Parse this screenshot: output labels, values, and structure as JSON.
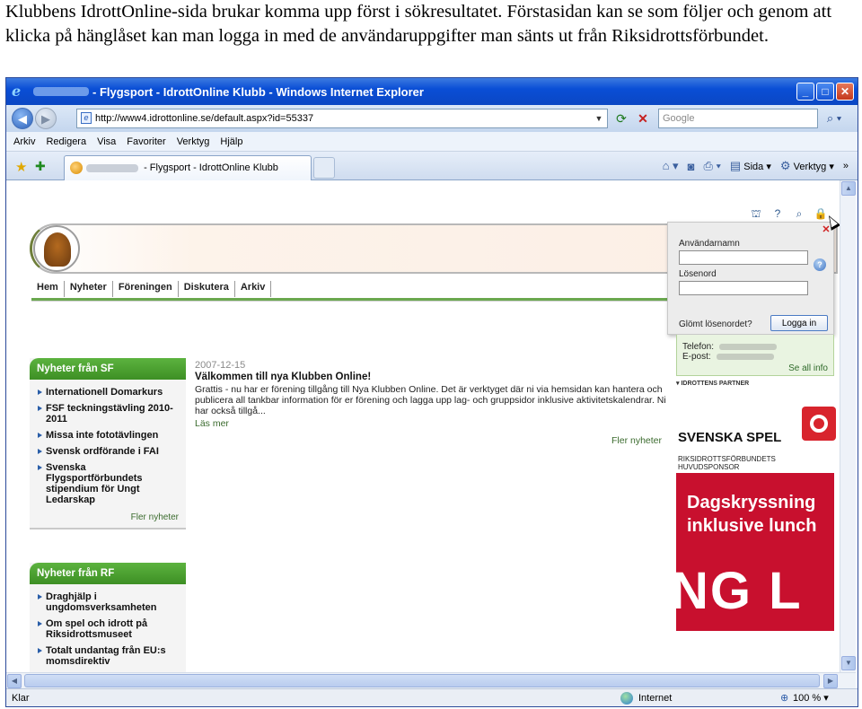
{
  "caption": "Klubbens IdrottOnline-sida brukar komma upp först i sökresultatet. Förstasidan kan se som följer och genom att klicka på hänglåset kan man logga in med de användaruppgifter man sänts ut från Riksidrottsförbundet.",
  "window": {
    "title": "- Flygsport - IdrottOnline Klubb - Windows Internet Explorer",
    "minimize_icon": "minimize-icon",
    "maximize_icon": "maximize-icon",
    "close_icon": "close-icon"
  },
  "navigation": {
    "address": "http://www4.idrottonline.se/default.aspx?id=55337",
    "search_placeholder": "Google"
  },
  "menu": [
    "Arkiv",
    "Redigera",
    "Visa",
    "Favoriter",
    "Verktyg",
    "Hjälp"
  ],
  "tab": {
    "label": "- Flygsport - IdrottOnline Klubb"
  },
  "commandbar": {
    "page": "Sida",
    "tools": "Verktyg"
  },
  "site": {
    "nav": [
      "Hem",
      "Nyheter",
      "Föreningen",
      "Diskutera",
      "Arkiv"
    ]
  },
  "login": {
    "username_label": "Användarnamn",
    "password_label": "Lösenord",
    "forgot": "Glömt lösenordet?",
    "button": "Logga in",
    "help": "?"
  },
  "contact": {
    "phone_label": "Telefon:",
    "email_label": "E-post:",
    "more": "Se all info"
  },
  "partners": {
    "label": "IDROTTENS PARTNER",
    "spel_name": "SVENSKA SPEL",
    "spel_sub": "RIKSIDROTTSFÖRBUNDETS HUVUDSPONSOR",
    "ad_line1": "Dagskryssning",
    "ad_line2": "inklusive lunch",
    "ad_big": "NG L"
  },
  "sf_news": {
    "header": "Nyheter från SF",
    "items": [
      "Internationell Domarkurs",
      "FSF teckningstävling 2010-2011",
      "Missa inte fototävlingen",
      "Svensk ordförande i FAI",
      "Svenska Flygsportförbundets stipendium för Ungt Ledarskap"
    ],
    "more": "Fler nyheter"
  },
  "rf_news": {
    "header": "Nyheter från RF",
    "items": [
      "Draghjälp i ungdomsverksamheten",
      "Om spel och idrott på Riksidrottsmuseet",
      "Totalt undantag från EU:s momsdirektiv"
    ]
  },
  "news": {
    "date": "2007-12-15",
    "title": "Välkommen till nya Klubben Online!",
    "body": "Grattis - nu har er förening tillgång till Nya Klubben Online. Det är verktyget där ni via hemsidan kan hantera och publicera all tankbar information för er förening och lagga upp lag- och gruppsidor inklusive aktivitetskalendrar. Ni har också tillgå...",
    "readmore": "Läs mer",
    "more": "Fler nyheter"
  },
  "status": {
    "text": "Klar",
    "zone": "Internet",
    "zoom": "100 %"
  }
}
